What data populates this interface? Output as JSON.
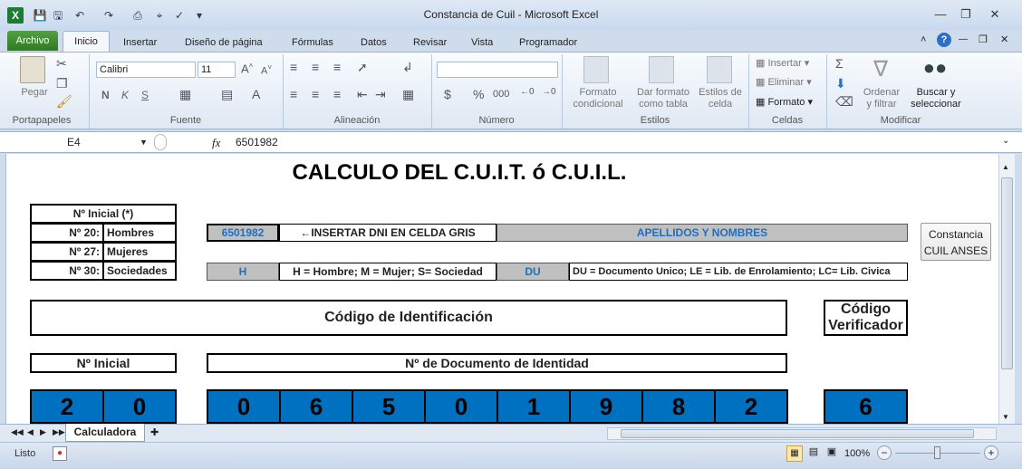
{
  "window": {
    "title": "Constancia de Cuil  -  Microsoft Excel"
  },
  "tabs": {
    "archivo": "Archivo",
    "inicio": "Inicio",
    "insertar": "Insertar",
    "diseno": "Diseño de página",
    "formulas": "Fórmulas",
    "datos": "Datos",
    "revisar": "Revisar",
    "vista": "Vista",
    "programador": "Programador"
  },
  "ribbon": {
    "portapapeles": {
      "label": "Portapapeles",
      "pegar": "Pegar"
    },
    "fuente": {
      "label": "Fuente",
      "font": "Calibri",
      "size": "11"
    },
    "alineacion": {
      "label": "Alineación"
    },
    "numero": {
      "label": "Número",
      "pct": "%",
      "thousands": "000"
    },
    "estilos": {
      "label": "Estilos",
      "formato_cond_1": "Formato",
      "formato_cond_2": "condicional",
      "dar_formato_1": "Dar formato",
      "dar_formato_2": "como tabla",
      "estilos_celda_1": "Estilos de",
      "estilos_celda_2": "celda"
    },
    "celdas": {
      "label": "Celdas",
      "insertar": "Insertar",
      "eliminar": "Eliminar",
      "formato": "Formato"
    },
    "modificar": {
      "label": "Modificar",
      "ordenar_1": "Ordenar",
      "ordenar_2": "y filtrar",
      "buscar_1": "Buscar y",
      "buscar_2": "seleccionar"
    }
  },
  "formula_bar": {
    "cell_ref": "E4",
    "fx": "fx",
    "value": "6501982"
  },
  "sheet": {
    "title": "CALCULO DEL C.U.I.T. ó C.U.I.L.",
    "legend": {
      "header": "Nº Inicial (*)",
      "r1_code": "Nº 20:",
      "r1_label": "Hombres",
      "r2_code": "Nº 27:",
      "r2_label": "Mujeres",
      "r3_code": "Nº 30:",
      "r3_label": "Sociedades"
    },
    "dni_value": "6501982",
    "dni_hint": "←INSERTAR DNI EN CELDA GRIS",
    "apellidos": "APELLIDOS Y NOMBRES",
    "sexo_value": "H",
    "sexo_hint": "H = Hombre; M = Mujer; S= Sociedad",
    "doc_type": "DU",
    "doc_hint": "DU = Documento Unico; LE = Lib. de Enrolamiento; LC= Lib. Civica",
    "constancia_btn_1": "Constancia",
    "constancia_btn_2": "CUIL ANSES",
    "codigo_identificacion": "Código de Identificación",
    "codigo_verificador_1": "Código",
    "codigo_verificador_2": "Verificador",
    "inicial_label": "Nº Inicial",
    "documento_label": "Nº de Documento de Identidad",
    "inicial_digits": [
      "2",
      "0"
    ],
    "doc_digits": [
      "0",
      "6",
      "5",
      "0",
      "1",
      "9",
      "8",
      "2"
    ],
    "verificador_digit": "6"
  },
  "sheet_tabs": {
    "active": "Calculadora"
  },
  "status": {
    "ready": "Listo",
    "zoom": "100%"
  }
}
